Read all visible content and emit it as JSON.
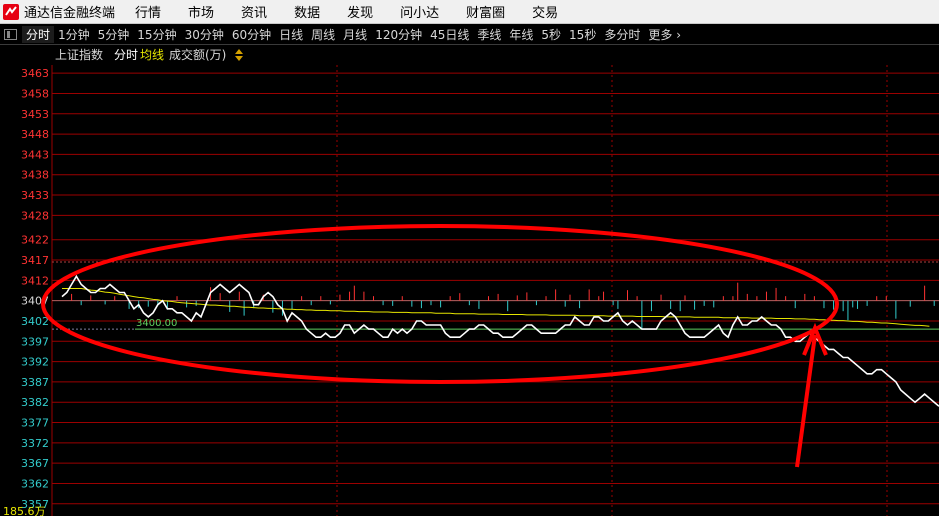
{
  "app": {
    "title": "通达信金融终端"
  },
  "menu": [
    "行情",
    "市场",
    "资讯",
    "数据",
    "发现",
    "问小达",
    "财富圈",
    "交易"
  ],
  "tabs": [
    "分时",
    "1分钟",
    "5分钟",
    "15分钟",
    "30分钟",
    "60分钟",
    "日线",
    "周线",
    "月线",
    "120分钟",
    "45日线",
    "季线",
    "年线",
    "5秒",
    "15秒",
    "多分时",
    "更多"
  ],
  "active_tab": "分时",
  "chart_header": {
    "index_name": "上证指数",
    "mode": "分时",
    "avg_label": "均线",
    "volume_label": "成交额(万)"
  },
  "colors": {
    "up": "#ff3333",
    "down": "#33cccc",
    "price_line": "#ffffff",
    "avg_line": "#e6e600",
    "grid": "#9b0000",
    "ref_line": "#60d060",
    "annotation": "#ff0000"
  },
  "chart_data": {
    "type": "line",
    "y_ticks": [
      3463,
      3458,
      3453,
      3448,
      3443,
      3438,
      3433,
      3428,
      3422,
      3417,
      3412,
      3407,
      3402,
      3397,
      3392,
      3387,
      3382,
      3377,
      3372,
      3367,
      3362,
      3357
    ],
    "ylim": [
      3354,
      3465
    ],
    "ref_level": 3400.0,
    "ref_label": "3400.00",
    "prev_close": 3407,
    "volume_axis_label": "185.6万",
    "price": [
      3408,
      3409,
      3411,
      3413,
      3411,
      3410,
      3409,
      3409,
      3410,
      3410,
      3411,
      3410,
      3409,
      3409,
      3407,
      3405,
      3406,
      3404,
      3403,
      3404,
      3406,
      3407,
      3405,
      3405,
      3404,
      3404,
      3403,
      3402,
      3404,
      3403,
      3406,
      3409,
      3410,
      3411,
      3410,
      3409,
      3410,
      3411,
      3410,
      3409,
      3406,
      3406,
      3408,
      3409,
      3408,
      3406,
      3405,
      3402,
      3404,
      3403,
      3402,
      3400,
      3399,
      3398,
      3398,
      3399,
      3398,
      3398,
      3399,
      3401,
      3401,
      3399,
      3400,
      3401,
      3400,
      3400,
      3399,
      3398,
      3398,
      3400,
      3399,
      3400,
      3399,
      3400,
      3402,
      3402,
      3401,
      3401,
      3401,
      3401,
      3399,
      3398,
      3398,
      3398,
      3399,
      3400,
      3400,
      3401,
      3401,
      3400,
      3399,
      3399,
      3398,
      3398,
      3398,
      3399,
      3400,
      3401,
      3401,
      3400,
      3399,
      3399,
      3399,
      3399,
      3400,
      3401,
      3401,
      3403,
      3402,
      3401,
      3401,
      3403,
      3403,
      3402,
      3402,
      3403,
      3404,
      3402,
      3401,
      3402,
      3401,
      3400,
      3400,
      3400,
      3400,
      3402,
      3403,
      3404,
      3403,
      3401,
      3399,
      3398,
      3398,
      3398,
      3398,
      3399,
      3400,
      3401,
      3399,
      3398,
      3401,
      3403,
      3401,
      3401,
      3402,
      3402,
      3403,
      3402,
      3401,
      3401,
      3400,
      3398,
      3398,
      3397,
      3397,
      3398,
      3399,
      3398,
      3397,
      3396,
      3395,
      3395,
      3394,
      3393,
      3393,
      3392,
      3391,
      3390,
      3389,
      3389,
      3390,
      3390,
      3389,
      3388,
      3387,
      3385,
      3384,
      3383,
      3382,
      3383,
      3384,
      3383,
      3382,
      3381
    ],
    "avg": [
      3410,
      3410,
      3410,
      3410,
      3410,
      3409.8,
      3409.6,
      3409.5,
      3409.3,
      3409.1,
      3409,
      3408.8,
      3408.6,
      3408.4,
      3408.2,
      3408,
      3407.8,
      3407.7,
      3407.5,
      3407.3,
      3407.2,
      3407,
      3406.9,
      3406.8,
      3406.6,
      3406.5,
      3406.4,
      3406.3,
      3406.2,
      3406.1,
      3406,
      3405.9,
      3405.9,
      3405.8,
      3405.7,
      3405.6,
      3405.6,
      3405.5,
      3405.4,
      3405.4,
      3405.3,
      3405.2,
      3405.2,
      3405.1,
      3405.1,
      3405,
      3405,
      3404.9,
      3404.9,
      3404.8,
      3404.8,
      3404.7,
      3404.7,
      3404.6,
      3404.6,
      3404.6,
      3404.5,
      3404.5,
      3404.5,
      3404.4,
      3404.4,
      3404.4,
      3404.3,
      3404.3,
      3404.3,
      3404.2,
      3404.2,
      3404.2,
      3404.2,
      3404.1,
      3404.1,
      3404.1,
      3404.1,
      3404,
      3404,
      3404,
      3404,
      3404,
      3403.9,
      3403.9,
      3403.9,
      3403.9,
      3403.8,
      3403.8,
      3403.8,
      3403.8,
      3403.8,
      3403.7,
      3403.7,
      3403.7,
      3403.7,
      3403.7,
      3403.6,
      3403.6,
      3403.6,
      3403.6,
      3403.6,
      3403.5,
      3403.5,
      3403.5,
      3403.5,
      3403.5,
      3403.4,
      3403.4,
      3403.4,
      3403.4,
      3403.4,
      3403.4,
      3403.3,
      3403.3,
      3403.3,
      3403.3,
      3403.3,
      3403.3,
      3403.2,
      3403.2,
      3403.2,
      3403.2,
      3403.2,
      3403.2,
      3403.1,
      3403.1,
      3403.1,
      3403.1,
      3403.1,
      3403.1,
      3403,
      3403,
      3403,
      3403,
      3403,
      3403,
      3402.9,
      3402.9,
      3402.9,
      3402.9,
      3402.9,
      3402.9,
      3402.8,
      3402.8,
      3402.8,
      3402.8,
      3402.8,
      3402.8,
      3402.7,
      3402.7,
      3402.7,
      3402.7,
      3402.7,
      3402.6,
      3402.6,
      3402.6,
      3402.6,
      3402.5,
      3402.5,
      3402.5,
      3402.4,
      3402.4,
      3402.3,
      3402.3,
      3402.2,
      3402.2,
      3402.1,
      3402.1,
      3402,
      3401.9,
      3401.9,
      3401.8,
      3401.7,
      3401.7,
      3401.6,
      3401.5,
      3401.5,
      3401.4,
      3401.3,
      3401.2,
      3401.1,
      3401,
      3400.9,
      3400.9,
      3400.8,
      3400.7
    ],
    "volume_bars": [
      {
        "i": 2,
        "v": 0.45
      },
      {
        "i": 4,
        "v": -0.3
      },
      {
        "i": 6,
        "v": 0.35
      },
      {
        "i": 9,
        "v": -0.25
      },
      {
        "i": 11,
        "v": 0.3
      },
      {
        "i": 14,
        "v": -0.55
      },
      {
        "i": 16,
        "v": -0.5
      },
      {
        "i": 18,
        "v": -0.4
      },
      {
        "i": 20,
        "v": -0.3
      },
      {
        "i": 22,
        "v": -0.6
      },
      {
        "i": 24,
        "v": 0.3
      },
      {
        "i": 26,
        "v": -0.45
      },
      {
        "i": 28,
        "v": -0.35
      },
      {
        "i": 31,
        "v": 0.9
      },
      {
        "i": 33,
        "v": 0.5
      },
      {
        "i": 35,
        "v": -0.75
      },
      {
        "i": 37,
        "v": 0.6
      },
      {
        "i": 38,
        "v": -1.0
      },
      {
        "i": 40,
        "v": -0.5
      },
      {
        "i": 42,
        "v": 0.4
      },
      {
        "i": 44,
        "v": -0.8
      },
      {
        "i": 46,
        "v": -1.0
      },
      {
        "i": 48,
        "v": -0.6
      },
      {
        "i": 50,
        "v": 0.3
      },
      {
        "i": 52,
        "v": -0.3
      },
      {
        "i": 54,
        "v": 0.3
      },
      {
        "i": 56,
        "v": -0.25
      },
      {
        "i": 58,
        "v": 0.4
      },
      {
        "i": 60,
        "v": 0.6
      },
      {
        "i": 61,
        "v": 1.0
      },
      {
        "i": 63,
        "v": 0.6
      },
      {
        "i": 65,
        "v": 0.3
      },
      {
        "i": 67,
        "v": -0.3
      },
      {
        "i": 69,
        "v": -0.35
      },
      {
        "i": 71,
        "v": 0.3
      },
      {
        "i": 73,
        "v": -0.4
      },
      {
        "i": 75,
        "v": -0.5
      },
      {
        "i": 77,
        "v": -0.3
      },
      {
        "i": 79,
        "v": -0.45
      },
      {
        "i": 81,
        "v": 0.3
      },
      {
        "i": 83,
        "v": 0.5
      },
      {
        "i": 85,
        "v": -0.3
      },
      {
        "i": 87,
        "v": -0.55
      },
      {
        "i": 89,
        "v": 0.3
      },
      {
        "i": 91,
        "v": 0.45
      },
      {
        "i": 93,
        "v": -0.7
      },
      {
        "i": 95,
        "v": 0.35
      },
      {
        "i": 97,
        "v": 0.55
      },
      {
        "i": 99,
        "v": -0.3
      },
      {
        "i": 101,
        "v": 0.3
      },
      {
        "i": 103,
        "v": 0.75
      },
      {
        "i": 105,
        "v": -0.4
      },
      {
        "i": 106,
        "v": 0.4
      },
      {
        "i": 108,
        "v": -0.5
      },
      {
        "i": 110,
        "v": 0.75
      },
      {
        "i": 112,
        "v": 0.3
      },
      {
        "i": 113,
        "v": 0.6
      },
      {
        "i": 115,
        "v": -0.3
      },
      {
        "i": 116,
        "v": -0.55
      },
      {
        "i": 118,
        "v": 0.7
      },
      {
        "i": 120,
        "v": 0.3
      },
      {
        "i": 121,
        "v": -1.9
      },
      {
        "i": 123,
        "v": -0.7
      },
      {
        "i": 125,
        "v": 0.4
      },
      {
        "i": 127,
        "v": -0.55
      },
      {
        "i": 129,
        "v": -0.7
      },
      {
        "i": 130,
        "v": 0.35
      },
      {
        "i": 132,
        "v": -0.6
      },
      {
        "i": 134,
        "v": -0.35
      },
      {
        "i": 136,
        "v": -0.45
      },
      {
        "i": 138,
        "v": 0.3
      },
      {
        "i": 140,
        "v": 0.3
      },
      {
        "i": 141,
        "v": 1.2
      },
      {
        "i": 143,
        "v": 0.45
      },
      {
        "i": 145,
        "v": 0.3
      },
      {
        "i": 147,
        "v": 0.6
      },
      {
        "i": 149,
        "v": 0.85
      },
      {
        "i": 151,
        "v": 0.3
      },
      {
        "i": 153,
        "v": -0.5
      },
      {
        "i": 155,
        "v": 0.45
      },
      {
        "i": 157,
        "v": 0.3
      },
      {
        "i": 159,
        "v": -0.5
      },
      {
        "i": 161,
        "v": -0.6
      },
      {
        "i": 163,
        "v": -0.7
      },
      {
        "i": 164,
        "v": -1.3
      },
      {
        "i": 165,
        "v": -0.45
      },
      {
        "i": 166,
        "v": -0.55
      },
      {
        "i": 168,
        "v": -0.35
      },
      {
        "i": 170,
        "v": 0.3
      },
      {
        "i": 172,
        "v": 0.3
      },
      {
        "i": 174,
        "v": -1.2
      },
      {
        "i": 177,
        "v": -0.4
      },
      {
        "i": 180,
        "v": 1.0
      },
      {
        "i": 182,
        "v": -0.35
      }
    ]
  }
}
